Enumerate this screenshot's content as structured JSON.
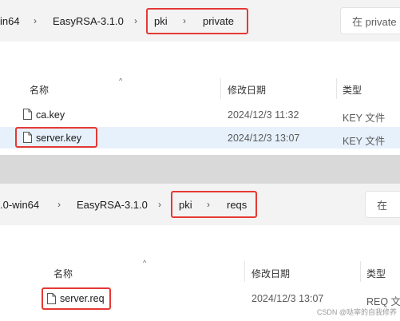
{
  "top": {
    "breadcrumbs": [
      "in64",
      "EasyRSA-3.1.0",
      "pki",
      "private"
    ],
    "search_placeholder": "在 private",
    "columns": {
      "name": "名称",
      "modified": "修改日期",
      "type": "类型"
    },
    "files": [
      {
        "name": "ca.key",
        "modified": "2024/12/3 11:32",
        "type": "KEY 文件"
      },
      {
        "name": "server.key",
        "modified": "2024/12/3 13:07",
        "type": "KEY 文件"
      }
    ]
  },
  "bottom": {
    "breadcrumbs": [
      ".0-win64",
      "EasyRSA-3.1.0",
      "pki",
      "reqs"
    ],
    "search_placeholder": "在",
    "columns": {
      "name": "名称",
      "modified": "修改日期",
      "type": "类型"
    },
    "files": [
      {
        "name": "server.req",
        "modified": "2024/12/3 13:07",
        "type": "REQ 文"
      }
    ]
  },
  "watermark": "CSDN @哒宰的自我修养",
  "colors": {
    "highlight": "#e53935",
    "selected_row": "#e6f1fb",
    "separator": "#d9d9d9"
  }
}
